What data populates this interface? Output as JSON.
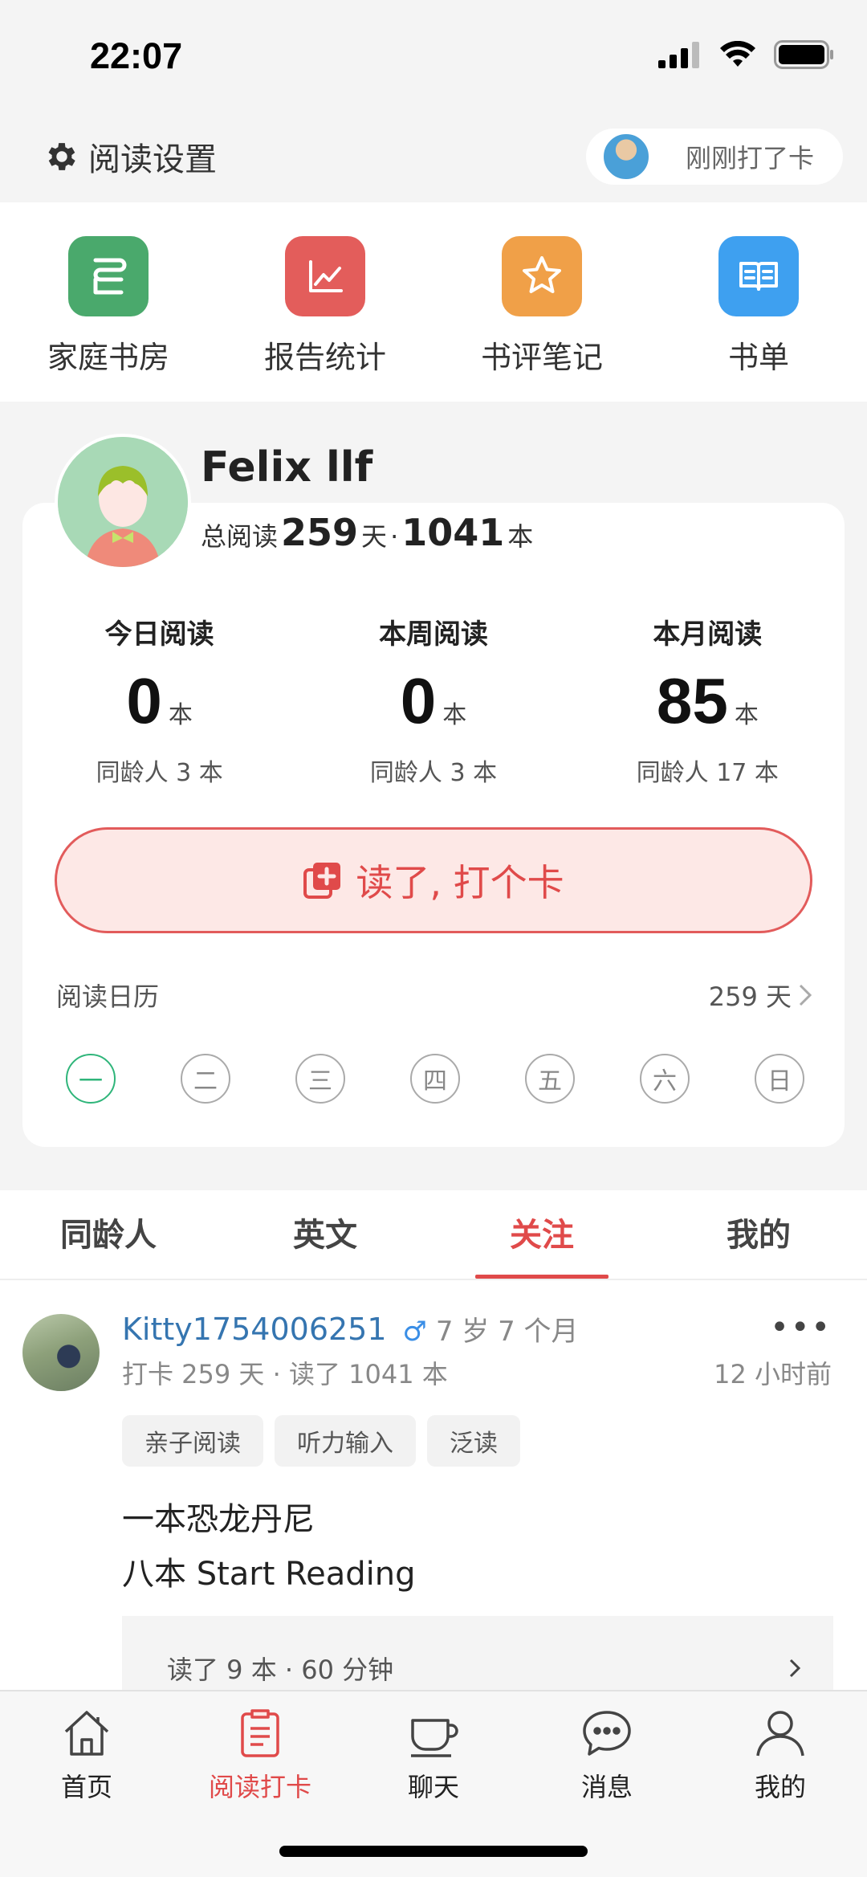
{
  "status_bar": {
    "time": "22:07"
  },
  "topbar": {
    "settings_label": "阅读设置",
    "checkin_notice": "刚刚打了卡"
  },
  "quick_actions": [
    {
      "label": "家庭书房",
      "icon": "bookshelf-icon",
      "color": "#4aa96c"
    },
    {
      "label": "报告统计",
      "icon": "chart-icon",
      "color": "#e35d5b"
    },
    {
      "label": "书评笔记",
      "icon": "star-icon",
      "color": "#f0a048"
    },
    {
      "label": "书单",
      "icon": "open-book-icon",
      "color": "#3ea0f0"
    }
  ],
  "profile": {
    "name": "Felix llf",
    "total_label": "总阅读",
    "total_days": "259",
    "days_unit": "天",
    "separator": "·",
    "total_books": "1041",
    "books_unit": "本"
  },
  "stats": [
    {
      "title": "今日阅读",
      "value": "0",
      "unit": "本",
      "peer": "同龄人 3 本"
    },
    {
      "title": "本周阅读",
      "value": "0",
      "unit": "本",
      "peer": "同龄人 3 本"
    },
    {
      "title": "本月阅读",
      "value": "85",
      "unit": "本",
      "peer": "同龄人 17 本"
    }
  ],
  "checkin_button": {
    "label": "读了, 打个卡"
  },
  "calendar": {
    "title": "阅读日历",
    "days_count": "259 天",
    "weekdays": [
      "一",
      "二",
      "三",
      "四",
      "五",
      "六",
      "日"
    ],
    "today_index": 0
  },
  "tabs": [
    {
      "label": "同龄人",
      "active": false
    },
    {
      "label": "英文",
      "active": false
    },
    {
      "label": "关注",
      "active": true
    },
    {
      "label": "我的",
      "active": false
    }
  ],
  "feed_post": {
    "username": "Kitty1754006251",
    "gender_symbol": "♂",
    "age": "7 岁 7 个月",
    "more": "•••",
    "stats_line": "打卡 259 天 · 读了 1041 本",
    "time_ago": "12 小时前",
    "tags": [
      "亲子阅读",
      "听力输入",
      "泛读"
    ],
    "lines": [
      "一本恐龙丹尼",
      "八本 Start Reading"
    ],
    "summary": "读了 9 本 · 60 分钟"
  },
  "bottom_nav": [
    {
      "label": "首页",
      "icon": "home-icon",
      "active": false
    },
    {
      "label": "阅读打卡",
      "icon": "checkin-clipboard-icon",
      "active": true
    },
    {
      "label": "聊天",
      "icon": "coffee-cup-icon",
      "active": false
    },
    {
      "label": "消息",
      "icon": "message-bubble-icon",
      "active": false
    },
    {
      "label": "我的",
      "icon": "profile-icon",
      "active": false
    }
  ],
  "colors": {
    "accent": "#e04a4a",
    "link": "#3575b0",
    "today": "#2fb57a"
  }
}
